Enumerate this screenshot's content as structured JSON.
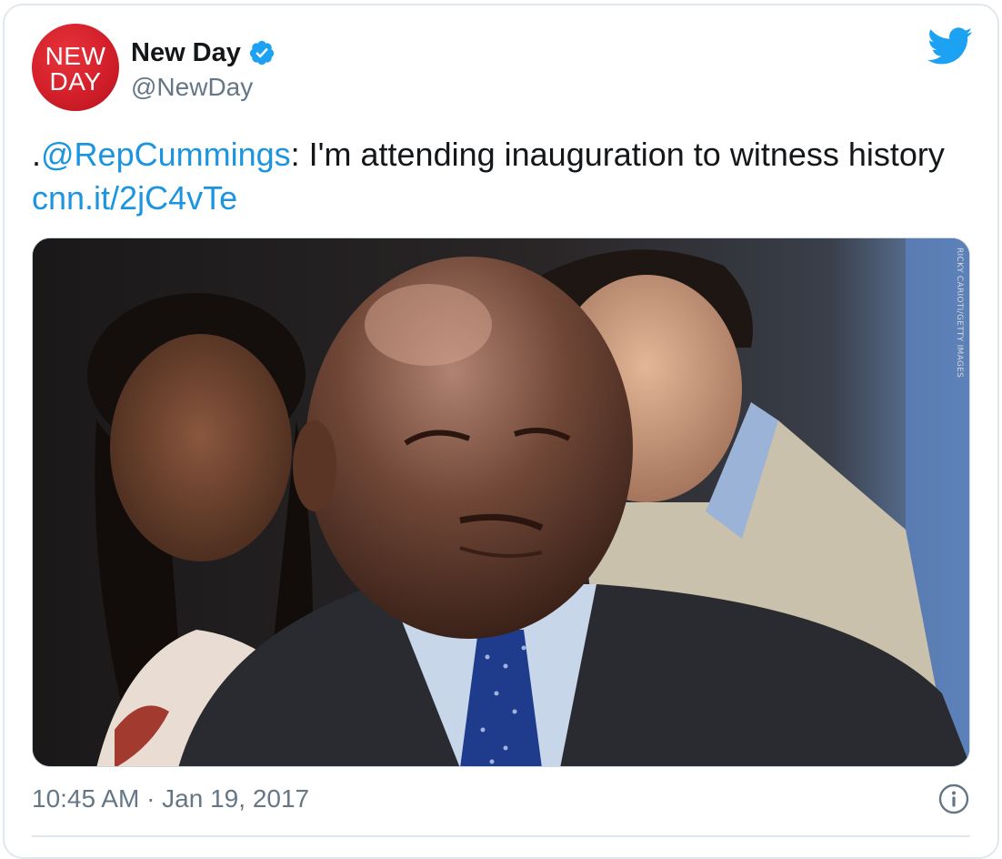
{
  "tweet": {
    "avatar": {
      "line1": "NEW",
      "line2": "DAY",
      "bg_color": "#d21f2a"
    },
    "display_name": "New Day",
    "verified_icon": "verified-badge-icon",
    "handle": "@NewDay",
    "platform_icon": "twitter-bird-icon",
    "text": {
      "prefix": ".",
      "mention": "@RepCummings",
      "body": ": I'm attending inauguration to witness history ",
      "link": "cnn.it/2jC4vTe"
    },
    "photo": {
      "credit": "RICKY CARIOTI/GETTY IMAGES"
    },
    "timestamp": "10:45 AM · Jan 19, 2017",
    "info_icon": "info-icon"
  },
  "colors": {
    "accent": "#1b95e0",
    "text_primary": "#14171a",
    "text_secondary": "#657786",
    "twitter_blue": "#1da1f2",
    "border": "#e1e8ed"
  }
}
